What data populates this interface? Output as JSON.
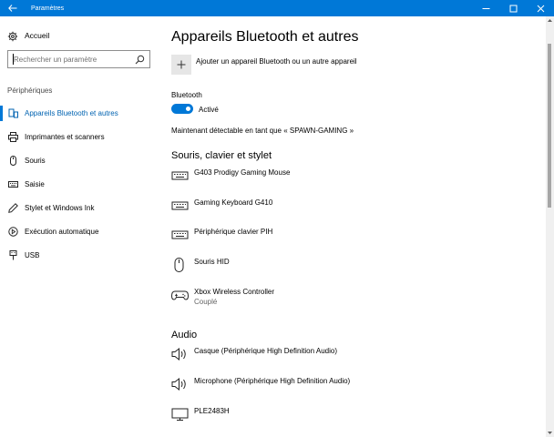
{
  "titlebar": {
    "title": "Paramètres",
    "bg_color": "#0078d7"
  },
  "nav": {
    "home_label": "Accueil",
    "search_placeholder": "Rechercher un paramètre",
    "section": "Périphériques",
    "items": [
      {
        "label": "Appareils Bluetooth et autres",
        "icon": "bluetooth-devices-icon",
        "active": true
      },
      {
        "label": "Imprimantes et scanners",
        "icon": "printer-icon",
        "active": false
      },
      {
        "label": "Souris",
        "icon": "mouse-icon",
        "active": false
      },
      {
        "label": "Saisie",
        "icon": "keyboard-icon",
        "active": false
      },
      {
        "label": "Stylet et Windows Ink",
        "icon": "pen-icon",
        "active": false
      },
      {
        "label": "Exécution automatique",
        "icon": "autoplay-icon",
        "active": false
      },
      {
        "label": "USB",
        "icon": "usb-icon",
        "active": false
      }
    ]
  },
  "main": {
    "title": "Appareils Bluetooth et autres",
    "add_device_label": "Ajouter un appareil Bluetooth ou un autre appareil",
    "bluetooth_label": "Bluetooth",
    "toggle_state": "Activé",
    "discoverable_text": "Maintenant détectable en tant que « SPAWN-GAMING »",
    "sections": [
      {
        "title": "Souris, clavier et stylet",
        "devices": [
          {
            "name": "G403 Prodigy Gaming Mouse",
            "status": "",
            "icon": "keyboard-icon"
          },
          {
            "name": "Gaming Keyboard G410",
            "status": "",
            "icon": "keyboard-icon"
          },
          {
            "name": "Périphérique clavier PIH",
            "status": "",
            "icon": "keyboard-icon"
          },
          {
            "name": "Souris HID",
            "status": "",
            "icon": "mouse-icon"
          },
          {
            "name": "Xbox Wireless Controller",
            "status": "Couplé",
            "icon": "gamepad-icon"
          }
        ]
      },
      {
        "title": "Audio",
        "devices": [
          {
            "name": "Casque (Périphérique High Definition Audio)",
            "status": "",
            "icon": "speaker-icon"
          },
          {
            "name": "Microphone (Périphérique High Definition Audio)",
            "status": "",
            "icon": "speaker-icon"
          },
          {
            "name": "PLE2483H",
            "status": "",
            "icon": "monitor-icon"
          }
        ]
      }
    ],
    "accent_color": "#0078d7"
  }
}
